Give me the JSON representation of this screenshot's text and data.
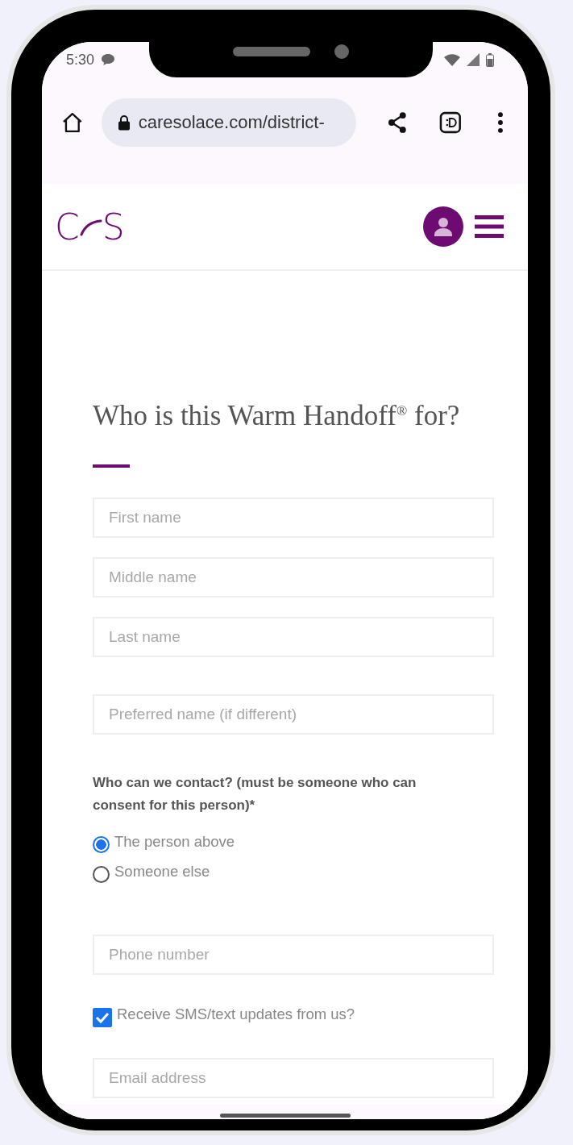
{
  "status_bar": {
    "time": "5:30"
  },
  "browser": {
    "url": "caresolace.com/district-"
  },
  "header": {
    "logo": {
      "left": "C",
      "right": "S"
    }
  },
  "form": {
    "title": "Who is this Warm Handoff$^{®}$ for?",
    "name_fields": [
      {
        "placeholder": "First name"
      },
      {
        "placeholder": "Middle name"
      },
      {
        "placeholder": "Last name"
      }
    ],
    "preferred_field": {
      "placeholder": "Preferred name (if different)"
    },
    "contact_question": "Who can we contact? (must be someone who can consent for this person)*",
    "contact_options": [
      {
        "label": "The person above",
        "selected": true
      },
      {
        "label": "Someone else",
        "selected": false
      }
    ],
    "phone_field": {
      "placeholder": "Phone number"
    },
    "sms_updates": {
      "label": "Receive SMS/text updates from us?",
      "checked": true
    },
    "email_field": {
      "placeholder": "Email address"
    }
  }
}
